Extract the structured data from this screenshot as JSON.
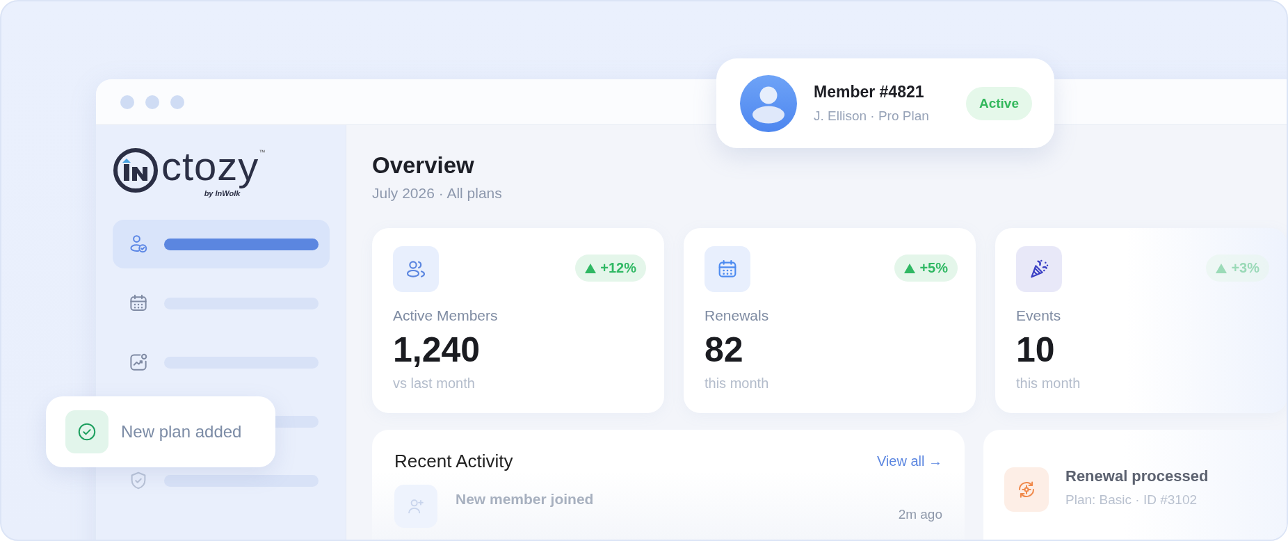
{
  "logo": {
    "wordmark": "ctozy",
    "trademark": "™",
    "tagline": "by InWolk"
  },
  "sidebar": {
    "items": [
      {
        "selected": true
      },
      {
        "selected": false
      },
      {
        "selected": false
      },
      {
        "selected": false
      },
      {
        "selected": false
      }
    ]
  },
  "toast": {
    "text": "New plan added"
  },
  "member_card": {
    "title": "Member #4821",
    "subtitle": "J. Ellison · Pro Plan",
    "status": "Active"
  },
  "header": {
    "title": "Overview",
    "subtitle": "July 2026 · All plans"
  },
  "stats": [
    {
      "label": "Active Members",
      "value": "1,240",
      "note": "vs last month",
      "change": "+12%"
    },
    {
      "label": "Renewals",
      "value": "82",
      "note": "this month",
      "change": "+5%"
    },
    {
      "label": "Events",
      "value": "10",
      "note": "this month",
      "change": "+3%"
    }
  ],
  "recent_activity": {
    "title": "Recent Activity",
    "link": "View all →",
    "items": [
      {
        "title": "New member joined",
        "time": "2m ago"
      }
    ]
  },
  "side_activity": {
    "title": "Renewal processed",
    "subtitle": "Plan: Basic · ID #3102"
  }
}
